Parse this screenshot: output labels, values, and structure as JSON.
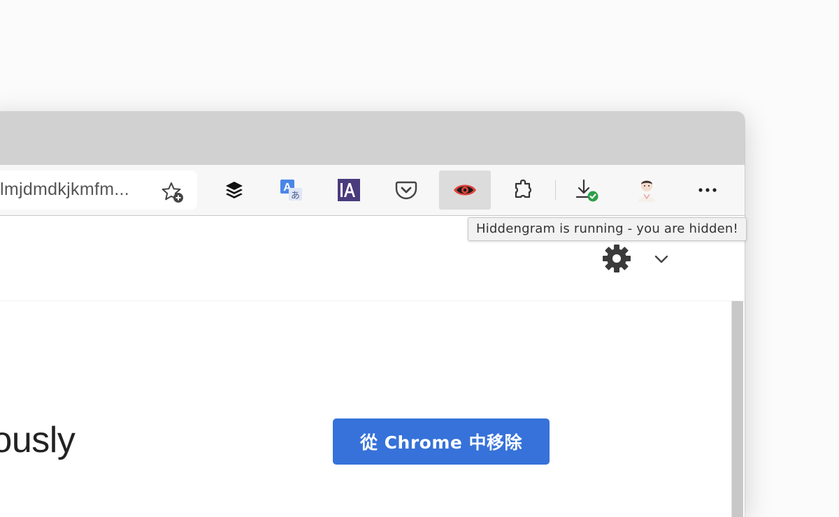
{
  "address_bar": {
    "url_text": "lmjdmdkjkmfm..."
  },
  "toolbar": {
    "extensions": [
      {
        "icon": "buffer-stack-icon"
      },
      {
        "icon": "translate-icon"
      },
      {
        "icon": "ia-writer-icon",
        "text": "IA"
      },
      {
        "icon": "pocket-icon"
      },
      {
        "icon": "hiddengram-eye-icon",
        "active": true
      },
      {
        "icon": "extensions-puzzle-icon"
      },
      {
        "icon": "download-complete-icon"
      },
      {
        "icon": "profile-avatar-icon"
      },
      {
        "icon": "more-menu-icon"
      }
    ]
  },
  "tooltip": {
    "text": "Hiddengram is running - you are hidden!"
  },
  "page": {
    "heading_fragment": "nously",
    "remove_button": "從 Chrome 中移除"
  },
  "colors": {
    "accent": "#3672d9",
    "hiddengram_red": "#e0443b",
    "ia_purple": "#4a3b7c",
    "download_check": "#2e9e4b"
  }
}
